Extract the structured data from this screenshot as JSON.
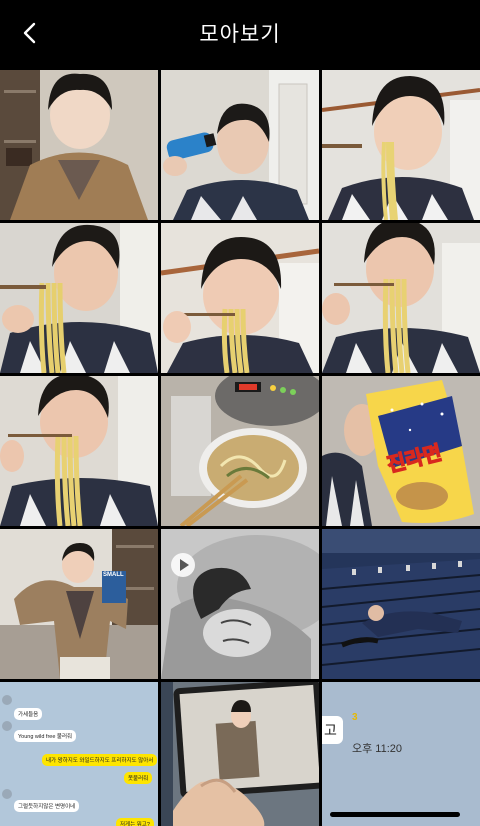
{
  "header": {
    "title": "모아보기",
    "back_icon": "chevron-left-icon"
  },
  "photos": [
    {
      "kind": "photo"
    },
    {
      "kind": "photo"
    },
    {
      "kind": "photo"
    },
    {
      "kind": "photo"
    },
    {
      "kind": "photo"
    },
    {
      "kind": "photo"
    },
    {
      "kind": "photo"
    },
    {
      "kind": "photo"
    },
    {
      "kind": "photo"
    },
    {
      "kind": "photo"
    },
    {
      "kind": "video"
    },
    {
      "kind": "photo"
    },
    {
      "kind": "screenshot"
    },
    {
      "kind": "photo"
    },
    {
      "kind": "screenshot"
    }
  ],
  "snack": {
    "package_text": "진라면"
  },
  "magazine": {
    "cover_text": "SMALL"
  },
  "chat": {
    "messages": [
      {
        "side": "left",
        "text": "가세들음"
      },
      {
        "side": "left",
        "text": "Young wild free 불러줘"
      },
      {
        "side": "right",
        "text": "내가 왕하지도 와일드하지도 프리하지도 않아서"
      },
      {
        "side": "right",
        "text": "못불러줘"
      },
      {
        "side": "left",
        "text": "그럴듯하지않은 변명이네"
      },
      {
        "side": "right",
        "text": "저게는 뭐고?"
      }
    ]
  },
  "message_preview": {
    "fragment": "고",
    "unread_count": "3",
    "time": "오후 11:20"
  },
  "colors": {
    "background": "#000000",
    "chat_bg": "#b2c7da",
    "my_bubble": "#fee500"
  }
}
